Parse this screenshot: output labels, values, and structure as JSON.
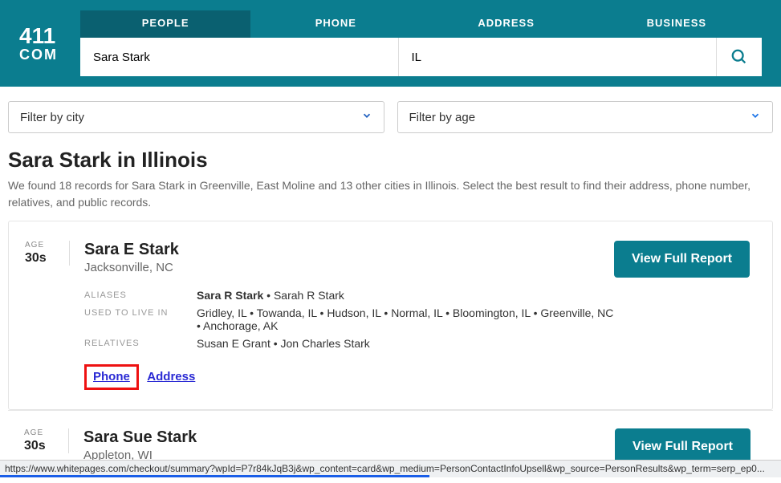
{
  "logo": {
    "line1": "411",
    "line2": "COM"
  },
  "tabs": {
    "people": "PEOPLE",
    "phone": "PHONE",
    "address": "ADDRESS",
    "business": "BUSINESS"
  },
  "search": {
    "name_value": "Sara Stark",
    "state_value": "IL"
  },
  "filters": {
    "city_label": "Filter by city",
    "age_label": "Filter by age"
  },
  "heading": {
    "title": "Sara Stark in Illinois",
    "subtitle": "We found 18 records for Sara Stark in Greenville, East Moline and 13 other cities in Illinois. Select the best result to find their address, phone number, relatives, and public records."
  },
  "labels": {
    "age": "AGE",
    "aliases": "ALIASES",
    "used_to_live_in": "USED TO LIVE IN",
    "relatives": "RELATIVES",
    "view_report": "View Full Report",
    "phone_link": "Phone",
    "address_link": "Address"
  },
  "results": [
    {
      "age": "30s",
      "name": "Sara E Stark",
      "location": "Jacksonville, NC",
      "alias_bold": "Sara R Stark",
      "alias_rest": " • Sarah R Stark",
      "used_to_live_in": "Gridley, IL • Towanda, IL • Hudson, IL • Normal, IL • Bloomington, IL • Greenville, NC • Anchorage, AK",
      "relatives": "Susan E Grant • Jon Charles Stark"
    },
    {
      "age": "30s",
      "name": "Sara Sue Stark",
      "location": "Appleton, WI"
    }
  ],
  "statusbar": "https://www.whitepages.com/checkout/summary?wpId=P7r84kJqB3j&wp_content=card&wp_medium=PersonContactInfoUpsell&wp_source=PersonResults&wp_term=serp_ep0..."
}
